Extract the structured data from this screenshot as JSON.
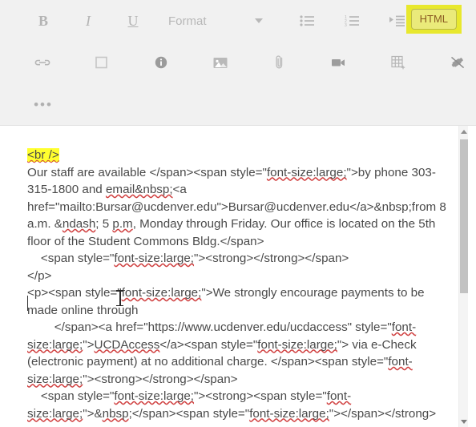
{
  "toolbar": {
    "row1": [
      {
        "name": "bold-button",
        "label": "B",
        "kind": "glyph-bold"
      },
      {
        "name": "italic-button",
        "label": "I",
        "kind": "glyph-italic"
      },
      {
        "name": "underline-button",
        "label": "U",
        "kind": "glyph-underline"
      }
    ],
    "format_dropdown": {
      "label": "Format",
      "icon": "chevron-down-icon"
    },
    "list_buttons": [
      {
        "name": "bulleted-list-button",
        "icon": "bulleted-list-icon"
      },
      {
        "name": "numbered-list-button",
        "icon": "numbered-list-icon"
      },
      {
        "name": "increase-indent-button",
        "icon": "increase-indent-icon"
      }
    ],
    "html_button": {
      "label": "HTML",
      "highlight_color": "#e8e82e",
      "button_color": "#eaea7a",
      "text_color": "#8a5a23"
    },
    "row2": [
      {
        "name": "insert-link-button",
        "icon": "link-icon"
      },
      {
        "name": "insert-box-button",
        "icon": "square-icon"
      },
      {
        "name": "info-button",
        "icon": "info-icon"
      },
      {
        "name": "insert-image-button",
        "icon": "image-icon"
      },
      {
        "name": "attach-file-button",
        "icon": "paperclip-icon"
      },
      {
        "name": "insert-video-button",
        "icon": "video-camera-icon"
      },
      {
        "name": "insert-table-button",
        "icon": "table-icon"
      },
      {
        "name": "remove-formatting-button",
        "icon": "eraser-icon"
      }
    ],
    "row3": {
      "more_button": {
        "name": "more-options-button",
        "label": "•••",
        "icon": "ellipsis-icon"
      }
    }
  },
  "editor": {
    "highlighted_snippet": "<br />",
    "body_lines": [
      "Our staff are available </span><span style=\"font-size:large;\">by phone 303-315-1800 and email&nbsp;<a href=\"mailto:Bursar@ucdenver.edu\">Bursar@ucdenver.edu</a>&nbsp;from 8 a.m. &ndash; 5 p.m, Monday through Friday. Our office is located on the 5th floor of the Student Commons Bldg.</span>",
      "    <span style=\"font-size:large;\"><strong></strong></span>",
      "</p>",
      "<p><span style=\"font-size:large;\">We strongly encourage payments to be made online through",
      "        </span><a href=\"https://www.ucdenver.edu/ucdaccess\" style=\"font-size:large;\">UCDAccess</a><span style=\"font-size:large;\"> via e-Check (electronic payment) at no additional charge. </span><span style=\"font-size:large;\"><strong></strong></span>",
      "    <span style=\"font-size:large;\"><strong><span style=\"font-size:large;\">&nbsp;</span><span style=\"font-size:large;\"></span></strong>"
    ]
  },
  "scrollbar": {
    "up_arrow": "scroll-up-arrow",
    "down_arrow": "scroll-down-arrow",
    "thumb": "scroll-thumb"
  }
}
